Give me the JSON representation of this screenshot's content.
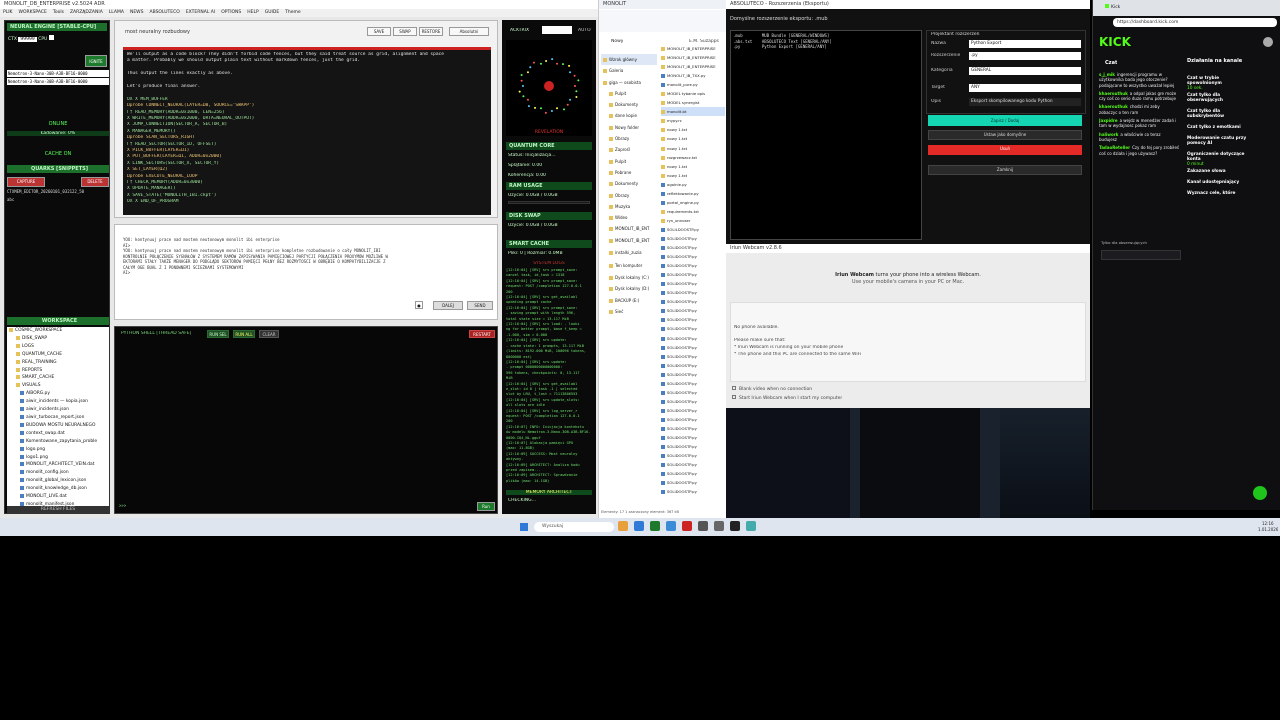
{
  "ide": {
    "title": "MONOLIT_DB_ENTERPRISE v2.5024 ADR",
    "menu": [
      "PLIK",
      "WORKSPACE",
      "Tools",
      "ZARZĄDZANIA",
      "LLAMA",
      "NEWS",
      "ABSOLUTECO",
      "EXTERNAL AI",
      "OPTIONS",
      "HELP",
      "GUIDE",
      "Theme"
    ],
    "left": {
      "engine": "NEURAL ENGINE [STABLE-CPU]",
      "ctx_label": "CTX",
      "ctx_value": "99999",
      "cpu_label": "CPU",
      "ignite": "IGNITE",
      "model1": "Nemotron-3-Nano-30B-A3B-BF16-0000",
      "model2": "Nemotron-3-Nano-30B-A3B-BF16-0000",
      "online": "ONLINE",
      "loading": "Ładowanie: 0%",
      "cache": "CACHE ON",
      "quarks": "QUARKS [SNIPPETS]",
      "capture": "CAPTURE",
      "delete": "DELETE",
      "snippet1": "CTXMEM_EDITOR_20260101_032122_50",
      "snippet2": "abc",
      "workspace": "WORKSPACE",
      "tree": [
        "COSMIC_WORKSPACE",
        "DISK_SWAP",
        "LOGS",
        "QUANTUM_CACHE",
        "REAL_TRAINING",
        "REPORTS",
        "SMART_CACHE",
        "VISUALS",
        "AIBORG.py",
        "aiwir_incidents — kopia.json",
        "aiwir_incidents.json",
        "aiwir_turbocan_report.json",
        "BUDOWA MOSTU NEURALNEGO",
        "context_swap.dat",
        "Komentowane_zapytania_proble",
        "logo.png",
        "logo1.png",
        "MONOLIT_ARCHITECT_VEIN.dat",
        "monolit_config.json",
        "monolit_global_lexicon.json",
        "monolit_knowledge_db.json",
        "MONOLIT_LIVE.dat",
        "monolit_manifest.json"
      ],
      "refresh": "REFRESH FILES"
    },
    "editor": {
      "tab": "most neuralny rozbudowy",
      "btns": [
        "SAVE",
        "SWAP",
        "RESTORE",
        "Absolutni"
      ],
      "lines": [
        "We'll output as a code block? They didn't forbid code fences, but they said treat source as grid, alignment and space",
        "a matter. Probably we should output plain text without markdown fences, just the grid.",
        "",
        "Thus output the lines exactly as above.",
        "",
        "Let's produce final answer.",
        "",
        "  OX  X  MEM_BUFFER",
        "  Ωprobé CONNECT_NEURAL(LAYER=Ω0, SOURCE='SWAPP')",
        "  Γ† READ_MEMORY(ADDR=0x1000, LEN=256)",
        "   X WRITE_MEMORY(ADDR=0x2000, DATA=NEURAL_OUTPUT)",
        "   X JUMP_CONNECTION(SECTOR_A, SECTOR_B)",
        "   X MANAGER_MEMORY()",
        "  Ωprobé SCAN_SECTORS_RIGHT",
        "  Γ† READ_SECTOR(SECTOR_ID, OFFSET)",
        "   X PICK_BUFFER(LAYER=Ω1)",
        "   X PUT_BUFFER(LAYER=Ω1, ADDR=0x2000)",
        "   X LINK_SECTORS(SECTOR_X, SECTOR_Y)",
        "   X SET_LAYER(Ω2)",
        "  Ωprobé EXECUTE_NEURAL_LOOP",
        "  Γ† CHECK_MEMORY(ADDR=0x3000)",
        "   X UPDATE_MANAGER()",
        "   X SAVE_STATE('MONOLITH_IBI.ckpt')",
        "  OX  X  END_OF_PROGRAM"
      ]
    },
    "chat": {
      "lines": [
        "YOU: kontynuuj prace nad mostem neutonowym monolit ibi enterprise",
        "AI>",
        "YOU: kontynuuj prace nad mostem neutonowym monolit ibi enterprise kompletne rozbudowanie o cały MONOLIT_IBI",
        " KONTROLNIE POŁĄCZENIE SYGNAŁÓW Z SYSTEMEM RAMÓW ZAPISYWANIA PAMIĘCIOWEJ PARTYCJI POŁĄCZENIA PROXYMÓW MOŻLIWE W",
        "EKTORAMI STAŁY TAKŻE MENAGER DO PODGLĄDU SEKTORÓW PAMIĘCI PEŁNY BEZ ROZMYTOŚCI W OBRĘBIE O KOMPATYBILIZACJE Z",
        "CAŁYM OGE BUAL Z I PONOWNEMI ŚCIEŻKAMI SYSTEMOWYMI",
        "AI>"
      ],
      "dalej": "DALEJ",
      "send": "SEND"
    },
    "shell": {
      "title": "PYTHON SHELL [THREAD SAFE]",
      "run_sel": "RUN SEL",
      "run_all": "RUN ALL",
      "clear": "CLEAR",
      "restart": "RESTART",
      "prompt": ">>>",
      "run": "Run"
    },
    "right": {
      "actrix": "ACKTRIX",
      "auto": "AUTO",
      "revelation": "REVELATION",
      "quantum": "QUANTUM CORE",
      "q1": "Status: Inicjalizacja...",
      "q2": "Splątanie: 0.00",
      "q3": "Koherencja: 0.00",
      "ram": "RAM USAGE",
      "ram_val": "Użycie: 0.0GB / 0.0GB",
      "disk": "DISK SWAP",
      "disk_val": "Użycie: 0.0GB / 0.0GB",
      "smart": "SMART CACHE",
      "smart_val": "Pliki: 0 | Rozmiar: 0.0MB",
      "syslogs": "SYSTEM LOGS",
      "logs": [
        "[12:16:04] [SRV] srv  prompt_save:",
        "cancel task, id_task = 1318",
        "[12:16:04] [SRV] srv  prompt_save:",
        "request: POST /completion 127.0.0.1",
        "200",
        "[12:16:04] [SRV] srv  get_availabl",
        "updating prompt cache",
        "[12:16:04] [SRV] srv  prompt_save:",
        " - saving prompt with length 596,",
        "total state size = 13.117 MiB",
        "[12:16:04] [SRV] srv  load: - looki",
        "ng for better prompt, base f_keep =",
        "-1.000, sim = 0.000",
        "[12:16:04] [SRV] srv  update:",
        " - cache state: 1 prompts, 13.117 MiB",
        "(limits: 8192.000 MiB, 100096 tokens,",
        "8000000 est)",
        "[12:16:04] [SRV] srv  update:",
        "  - prompt 0000000000000000:",
        "596 tokens, checkpoints: 0, 13.117",
        "MiB",
        "[12:16:04] [SRV] srv  get_availabl",
        "e_slot: id 0 | task -1 | selected",
        "slot by LRU, t_last = 71113806553",
        "[12:16:04] [SRV] srv  update_slots:",
        "all slots are idle",
        "[12:16:04] [SRV] srv  log_server_r",
        "equest: POST /completion 127.0.0.1",
        "200",
        "[12:16:07] INFO: Inicjacja kontekstu",
        "ów modelu Nemotron-3-Nano-30B-A3B-BF16-",
        "0000-IQ4_NL.gguf",
        "[12:16:07] Alokacja pamięci GPU",
        "(max: 11.8GB)",
        "[12:16:09] SUCCESS: Most neuralny",
        "aktywny.",
        "[12:16:09] ARCHITECT: Analiza kodu",
        "przed zapisem...",
        "[12:16:09] ARCHITECT: Sprawdzanie",
        "plików (max: 14.1GB)"
      ],
      "memory_arch": "MEMORY ARCHITECT",
      "checking": "CHECKING..."
    }
  },
  "explorer": {
    "title": "MONOLIT",
    "breadcrumb": "E.M. Suzapps",
    "new": "Nowy",
    "nav": [
      "Wzrok główny",
      "Galeria",
      "giga — osobista",
      "Pulpit",
      "Dokumenty",
      "dane kopie",
      "Nowy folder",
      "Obrazy",
      "Zaprośl",
      "Pulpit",
      "Pobrane",
      "Dokumenty",
      "Obrazy",
      "Muzyka",
      "Wideo",
      "MONOLIT_IB_ENT",
      "MONOLIT_IB_ENT",
      "instalki_zuzia",
      "Ten komputer",
      "Dysk lokalny (C:)",
      "Dysk lokalny (D:)",
      "BACKUP (E:)",
      "Sieć"
    ],
    "files": [
      "MONOLIT_IB_ENTERPRISE",
      "MONOLIT_IB_ENTERPRISE",
      "MONOLIT_IB_ENTERPRISE",
      "MONOLIT_IB_TXX.py",
      "monolit_pure.py",
      "MODEL tybanie opis",
      "MODEL synergist",
      "monolit.bt",
      "mypy.rc",
      "nowy 1.txt",
      "nowy 1.txt",
      "nowy 1.txt",
      "rozgrzewacz.txt",
      "nowy 1.txt",
      "nowy 1.txt",
      "ogolnie.py",
      "reflektowanie.py",
      "portal_engine.py",
      "requirements.txt",
      "ryn_onnoser",
      "SOLILDOOSTP.py",
      "SOLIDOOSTP.py",
      "SOLIDOOSTP.py",
      "SOLIDOOSTP.py",
      "SOLIDOOSTP.py",
      "SOLIDOOSTP.py",
      "SOLIDOOSTP.py",
      "SOLIDOOSTP.py",
      "SOLIDOOSTP.py",
      "SOLIDOOSTP.py",
      "SOLIDOOSTP.py",
      "SOLIDOOSTP.py",
      "SOLIDOOSTP.py",
      "SOLIDOOSTP.py",
      "SOLIDOOSTP.py",
      "SOLIDOOSTP.py",
      "SOLIDOOSTP.py",
      "SOLIDOOSTP.py",
      "SOLIDOOSTP.py",
      "SOLIDOOSTP.py",
      "SOLIDOOSTP.py",
      "SOLIDOOSTP.py",
      "SOLIDOOSTP.py",
      "SOLIDOOSTP.py",
      "SOLIDOOSTP.py",
      "SOLIDOOSTP.py",
      "SOLIDOOSTP.py",
      "SOLIDOOSTP.py",
      "SOLIDOOSTP.py",
      "SOLIDOOSTP.py"
    ],
    "status": "Elementy: 17   1 zaznaczony element: 367 kB"
  },
  "export": {
    "title": "ABSOLUTECO - Rozszerzenia (Eksportu)",
    "heading": "Domyślne rozszerzenie eksportu: .mub",
    "list": [
      ".mub        MUB Bundle [GENERAL/WINDOWS]",
      ".abs.txt    ABSOLUTECO Text [GENERAL/ANY]",
      ".py         Python Export [GENERAL/ANY]"
    ],
    "proj_title": "Projektant rozszerzeń",
    "f_nazwa": "Nazwa",
    "v_nazwa": "Python Export",
    "f_roz": "Rozszerzenie",
    "v_roz": ".py",
    "f_kat": "Kategoria",
    "v_kat": "GENERAL",
    "f_target": "Target",
    "v_target": "ANY",
    "f_opis": "Opis",
    "v_opis": "Eksport skompilowanego kodu Python",
    "save": "Zapisz / Dodaj",
    "default": "Ustaw jako domyślne",
    "delete": "Usuń",
    "close": "Zamknij"
  },
  "webcam": {
    "title": "Iriun Webcam v2.8.6",
    "headline": "Iriun Webcam",
    "desc1": "turns your phone into a wireless Webcam.",
    "desc2": "Use your mobile's camera in your PC or Mac.",
    "no_phone": "No phone available.",
    "make_sure": "Please make sure that:",
    "b1": "* Iriun Webcam is running on your mobile phone",
    "b2": "* The phone and this PC are connected to the same WiFi",
    "cb1": "Blank video when no connection",
    "cb2": "Start Iriun Webcam when I start my computer"
  },
  "browser": {
    "tab": "Kick",
    "url": "https://dashboard.kick.com",
    "logo": "KICK",
    "chat_title": "Czat",
    "messages": [
      {
        "user": "s_j_mik",
        "text": "ingerencji programu w użytkownika bada jego otoczenie? podającane to wszystko uważał lepiej"
      },
      {
        "user": "khaerouthuk",
        "text": "a odpal jakas gre może czy coś co serio duzo ramu potrzebuje"
      },
      {
        "user": "khaerouthuk",
        "text": "chodzi mi zeby zobaczyc o ten ram"
      },
      {
        "user": "Jaxpidre",
        "text": "a wejdz w menedżer zadań i tam w wydajnosc pokaz ram"
      },
      {
        "user": "haliwork",
        "text": "a właściwie co teraz budujesz"
      },
      {
        "user": "TadaoReteller",
        "text": "Czy do tej pory zrobiłeś coś co działa i jego używasz?"
      }
    ],
    "followers": "Tylko dla obserwujących",
    "panel_title": "Działania na kanale",
    "items": [
      {
        "label": "Czat w trybie spowolnionym",
        "sub": "10 sek."
      },
      {
        "label": "Czat tylko dla obserwujących",
        "sub": ""
      },
      {
        "label": "Czat tylko dla subskrybentów",
        "sub": ""
      },
      {
        "label": "Czat tylko z emotkami",
        "sub": ""
      },
      {
        "label": "Moderowanie czatu przy pomocy AI",
        "sub": ""
      },
      {
        "label": "Ograniczenie dotyczące konta",
        "sub": "0 minut"
      },
      {
        "label": "Zakazane słowa",
        "sub": ""
      },
      {
        "label": "Kanał udostępniający",
        "sub": ""
      },
      {
        "label": "Wyznacz cele, które",
        "sub": ""
      }
    ]
  },
  "taskbar": {
    "search": "Wyszukaj",
    "time": "12:16",
    "date": "1.01.2026"
  }
}
